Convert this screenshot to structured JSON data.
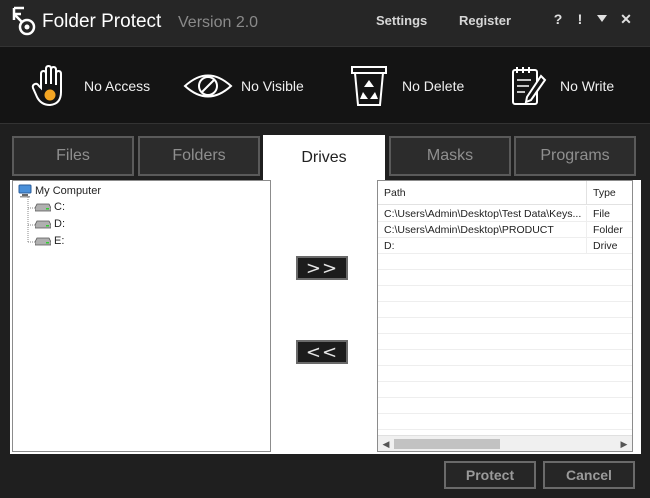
{
  "app": {
    "title": "Folder Protect",
    "version": "Version 2.0",
    "links": {
      "settings": "Settings",
      "register": "Register"
    },
    "window_buttons": {
      "help": "?",
      "info": "!",
      "minimize": "⮟",
      "close": "✕"
    }
  },
  "modes": [
    {
      "label": "No Access",
      "icon": "hand-icon"
    },
    {
      "label": "No Visible",
      "icon": "eye-icon"
    },
    {
      "label": "No Delete",
      "icon": "recycle-bin-icon"
    },
    {
      "label": "No Write",
      "icon": "notepad-pen-icon"
    }
  ],
  "tabs": [
    "Files",
    "Folders",
    "Drives",
    "Masks",
    "Programs"
  ],
  "active_tab": "Drives",
  "tree": {
    "root": "My Computer",
    "drives": [
      "C:",
      "D:",
      "E:"
    ]
  },
  "move_buttons": {
    "add": ">>",
    "remove": "<<"
  },
  "list": {
    "columns": [
      "Path",
      "Type"
    ],
    "rows": [
      {
        "path": "C:\\Users\\Admin\\Desktop\\Test Data\\Keys...",
        "type": "File"
      },
      {
        "path": "C:\\Users\\Admin\\Desktop\\PRODUCT",
        "type": "Folder"
      },
      {
        "path": "D:",
        "type": "Drive"
      }
    ]
  },
  "footer": {
    "protect": "Protect",
    "cancel": "Cancel"
  },
  "colors": {
    "accent": "#f5a623",
    "background": "#1f1f1f",
    "toolbar": "#141414"
  }
}
